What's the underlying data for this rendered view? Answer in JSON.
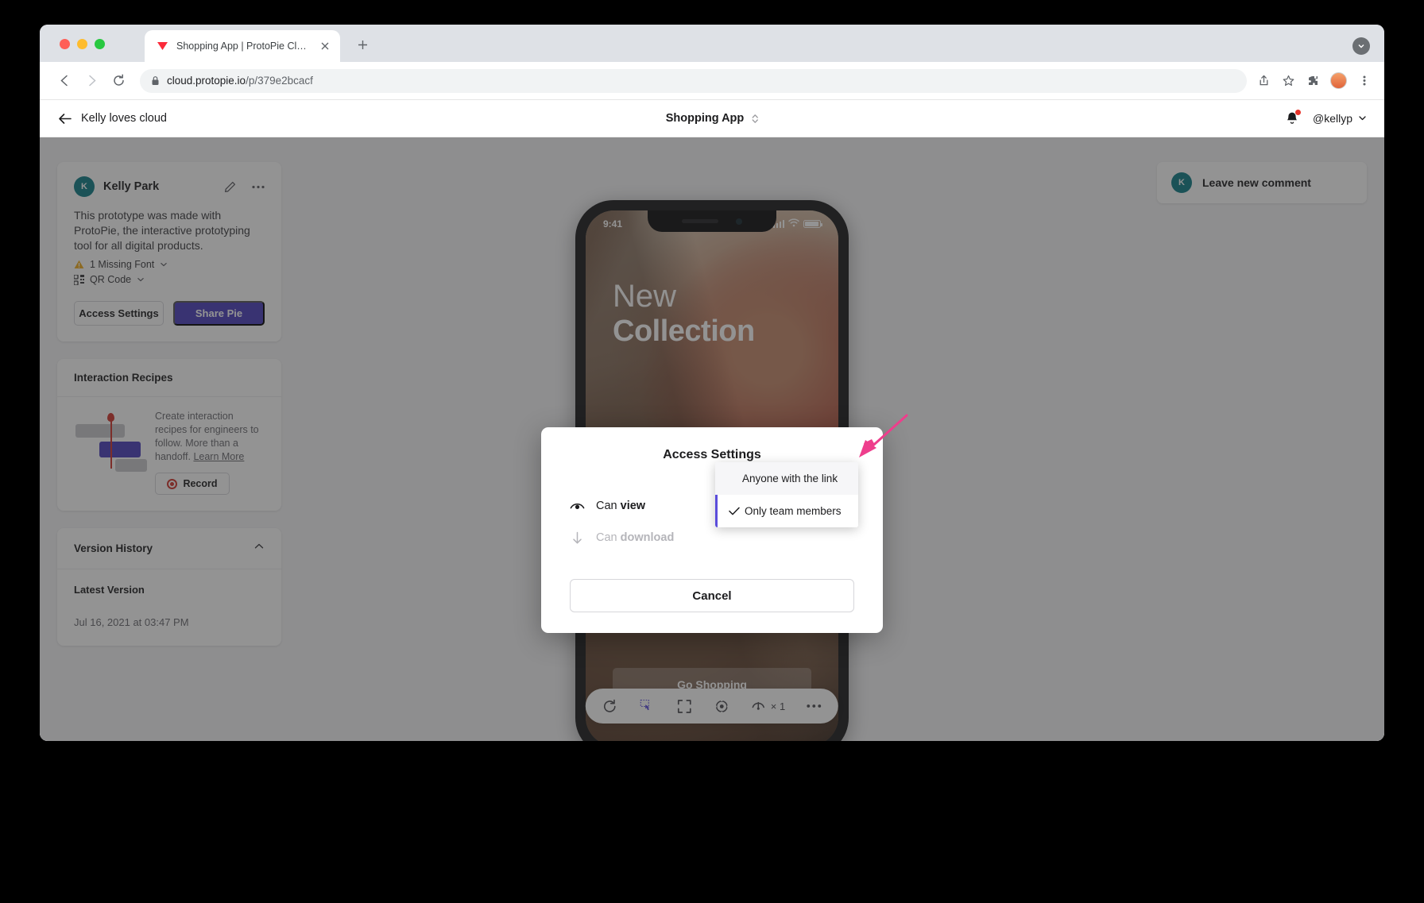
{
  "browser": {
    "tab": {
      "title": "Shopping App | ProtoPie Cloud",
      "favicon_icon": "protopie-logo-icon",
      "close_icon": "close-icon"
    },
    "newtab_icon": "plus-icon",
    "nav": {
      "back_icon": "arrow-left-icon",
      "forward_icon": "arrow-right-icon",
      "reload_icon": "reload-icon"
    },
    "omnibox": {
      "lock_icon": "lock-icon",
      "url_host": "cloud.protopie.io",
      "url_path": "/p/379e2bcacf"
    },
    "toolbar_icons": [
      "share-icon",
      "star-icon",
      "extensions-icon",
      "profile-avatar",
      "menu-kebab-icon"
    ],
    "window_right_icon": "chevron-down-circle-icon"
  },
  "app_header": {
    "back_icon": "arrow-left-icon",
    "project_name": "Kelly loves cloud",
    "title": "Shopping App",
    "title_switch_icon": "chevron-up-down-icon",
    "bell_icon": "bell-icon",
    "bell_has_badge": true,
    "user_handle": "@kellyp",
    "user_chevron_icon": "chevron-down-icon"
  },
  "sidebar": {
    "info_card": {
      "avatar_initial": "K",
      "author": "Kelly Park",
      "edit_icon": "pencil-icon",
      "more_icon": "ellipsis-icon",
      "description": "This prototype was made with ProtoPie, the interactive prototyping tool for all digital products.",
      "missing_font": {
        "icon": "warning-triangle-icon",
        "label": "1 Missing Font",
        "chevron_icon": "chevron-down-icon"
      },
      "qr_code": {
        "icon": "qr-code-icon",
        "label": "QR Code",
        "chevron_icon": "chevron-down-icon"
      },
      "access_settings_label": "Access Settings",
      "share_pie_label": "Share Pie"
    },
    "interaction_recipes": {
      "title": "Interaction Recipes",
      "description": "Create interaction recipes for engineers to follow. More than a handoff.",
      "link_label": "Learn More",
      "record_label": "Record",
      "record_icon": "record-icon"
    },
    "version_history": {
      "title": "Version History",
      "collapse_icon": "chevron-up-icon",
      "latest_label": "Latest Version",
      "latest_date": "Jul 16, 2021 at 03:47 PM"
    }
  },
  "comment_box": {
    "avatar_initial": "K",
    "label": "Leave new comment"
  },
  "phone": {
    "status_time": "9:41",
    "signal_icon": "cellular-bars-icon",
    "wifi_icon": "wifi-icon",
    "battery_icon": "battery-icon",
    "hero_line1": "New",
    "hero_line2": "Collection",
    "cta_label": "Go Shopping"
  },
  "bottom_toolbar": {
    "items": [
      {
        "icon": "reload-icon",
        "label": ""
      },
      {
        "icon": "touch-pointer-icon",
        "label": ""
      },
      {
        "icon": "fullscreen-icon",
        "label": ""
      },
      {
        "icon": "target-icon",
        "label": ""
      }
    ],
    "zoom_icon": "zoom-gauge-icon",
    "zoom_label": "× 1",
    "more_icon": "ellipsis-icon"
  },
  "modal": {
    "title": "Access Settings",
    "rows": [
      {
        "icon": "eye-icon",
        "prefix": "Can ",
        "strong": "view",
        "value": "Only team members",
        "chevron_icon": "chevron-up-icon",
        "disabled": false
      },
      {
        "icon": "download-arrow-icon",
        "prefix": "Can ",
        "strong": "download",
        "value": "",
        "chevron_icon": "",
        "disabled": true
      }
    ],
    "cancel_label": "Cancel"
  },
  "dropdown": {
    "items": [
      {
        "label": "Anyone with the link",
        "selected": false
      },
      {
        "label": "Only team members",
        "selected": true
      }
    ],
    "check_icon": "check-icon"
  },
  "colors": {
    "accent_purple": "#4a3fbd",
    "dropdown_accent": "#5b4ddb",
    "teal_avatar": "#0e7c86",
    "record_red": "#d0342c",
    "warning_yellow": "#f0ad1e",
    "cursor_pink": "#ee3e8c"
  }
}
